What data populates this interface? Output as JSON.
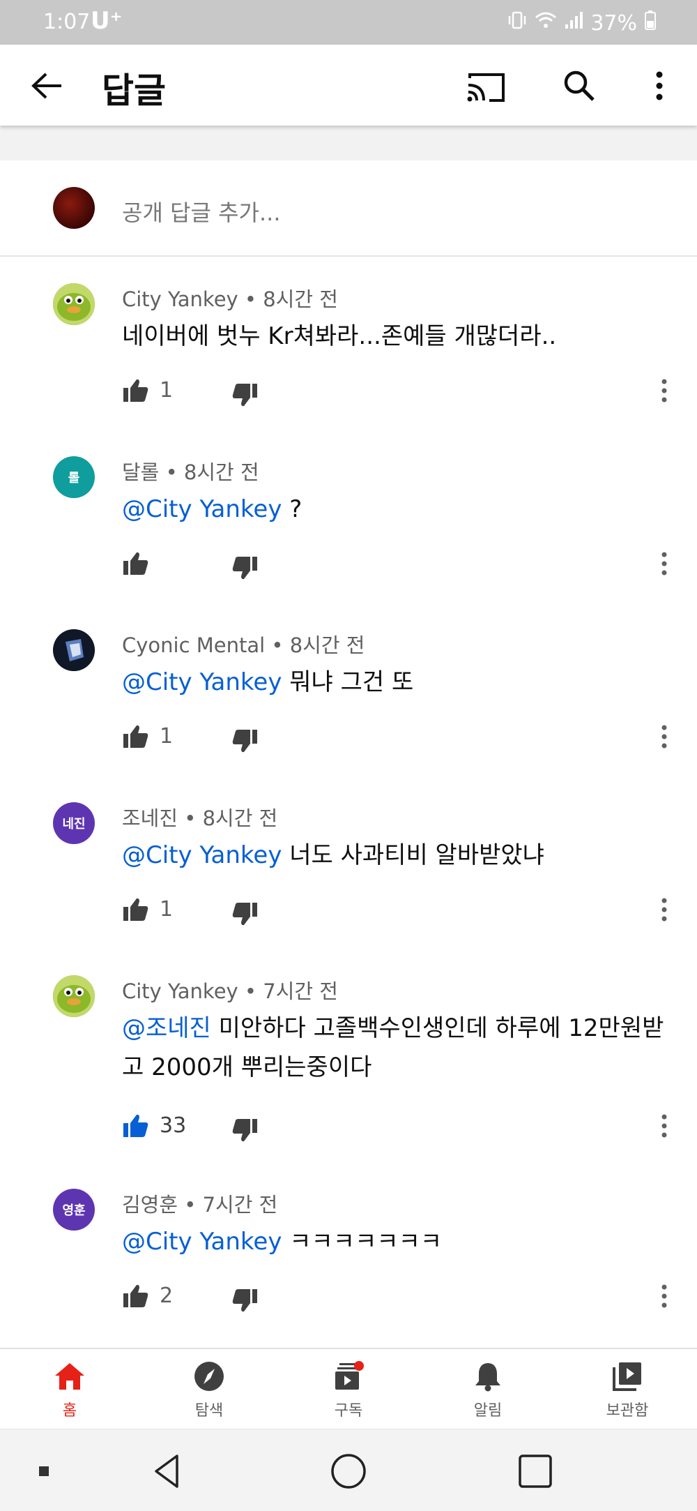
{
  "status_bar": {
    "time": "1:07",
    "carrier": "U⁺",
    "battery": "37%"
  },
  "app_bar": {
    "title": "답글"
  },
  "add_reply": {
    "placeholder": "공개 답글 추가..."
  },
  "comments": [
    {
      "author": "City Yankey",
      "time": "8시간 전",
      "mention": "",
      "text": "네이버에 벗누 Kr쳐봐라...존예들 개많더라..",
      "likes": "1",
      "liked": false,
      "avatar": {
        "type": "image",
        "color": "#9bbf2a",
        "text": ""
      }
    },
    {
      "author": "달롤",
      "time": "8시간 전",
      "mention": "@City Yankey",
      "text": "?",
      "likes": "",
      "liked": false,
      "avatar": {
        "type": "initials",
        "color": "#0f9d9d",
        "text": "롤"
      }
    },
    {
      "author": "Cyonic Mental",
      "time": "8시간 전",
      "mention": "@City Yankey",
      "text": "뭐냐 그건 또",
      "likes": "1",
      "liked": false,
      "avatar": {
        "type": "image",
        "color": "#15203a",
        "text": ""
      }
    },
    {
      "author": "조네진",
      "time": "8시간 전",
      "mention": "@City Yankey",
      "text": "너도 사과티비 알바받았냐",
      "likes": "1",
      "liked": false,
      "avatar": {
        "type": "initials",
        "color": "#5e35b1",
        "text": "네진"
      }
    },
    {
      "author": "City Yankey",
      "time": "7시간 전",
      "mention": "@조네진",
      "text": "미안하다 고졸백수인생인데 하루에 12만원받고 2000개 뿌리는중이다",
      "likes": "33",
      "liked": true,
      "avatar": {
        "type": "image",
        "color": "#9bbf2a",
        "text": ""
      }
    },
    {
      "author": "김영훈",
      "time": "7시간 전",
      "mention": "@City Yankey",
      "text": "ㅋㅋㅋㅋㅋㅋㅋ",
      "likes": "2",
      "liked": false,
      "avatar": {
        "type": "initials",
        "color": "#5e35b1",
        "text": "영훈"
      }
    }
  ],
  "bottom_nav": {
    "items": [
      {
        "label": "홈",
        "icon": "home-icon",
        "active": true
      },
      {
        "label": "탐색",
        "icon": "explore-icon",
        "active": false
      },
      {
        "label": "구독",
        "icon": "subscriptions-icon",
        "active": false
      },
      {
        "label": "알림",
        "icon": "bell-icon",
        "active": false
      },
      {
        "label": "보관함",
        "icon": "library-icon",
        "active": false
      }
    ]
  },
  "colors": {
    "accent_red": "#e62117",
    "mention_blue": "#065fd4",
    "liked_blue": "#065fd4"
  }
}
